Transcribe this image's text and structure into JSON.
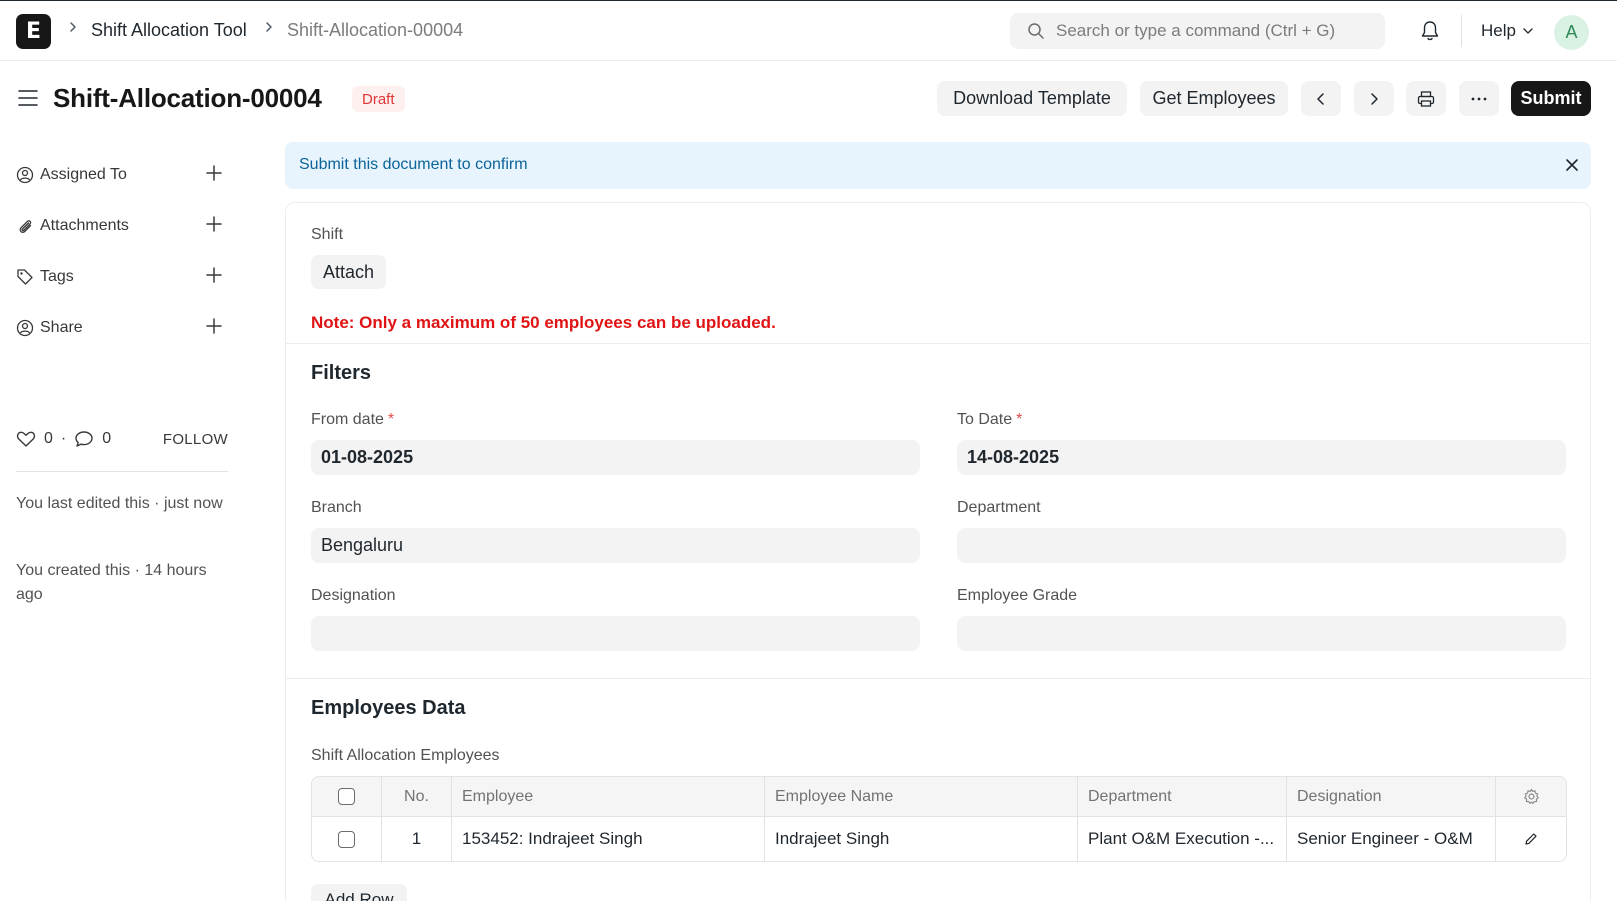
{
  "navbar": {
    "logo_letter": "E",
    "breadcrumbs": [
      "Shift Allocation Tool",
      "Shift-Allocation-00004"
    ],
    "search_placeholder": "Search or type a command (Ctrl + G)",
    "help_label": "Help",
    "avatar_letter": "A"
  },
  "page": {
    "title": "Shift-Allocation-00004",
    "status": "Draft",
    "buttons": {
      "download_template": "Download Template",
      "get_employees": "Get Employees",
      "submit": "Submit"
    }
  },
  "sidebar": {
    "items": [
      {
        "label": "Assigned To",
        "icon": "assign-user-icon"
      },
      {
        "label": "Attachments",
        "icon": "paperclip-icon"
      },
      {
        "label": "Tags",
        "icon": "tag-icon"
      },
      {
        "label": "Share",
        "icon": "share-user-icon"
      }
    ],
    "likes": "0",
    "comments": "0",
    "dot": "·",
    "follow_label": "FOLLOW",
    "last_edited": "You last edited this · just now",
    "created": "You created this · 14 hours ago"
  },
  "alert": {
    "message": "Submit this document to confirm"
  },
  "form": {
    "shift_label": "Shift",
    "attach_label": "Attach",
    "note": "Note: Only a maximum of 50 employees can be uploaded.",
    "filters_title": "Filters",
    "required_mark": "*",
    "fields": {
      "from_date": {
        "label": "From date",
        "value": "01-08-2025"
      },
      "to_date": {
        "label": "To Date",
        "value": "14-08-2025"
      },
      "branch": {
        "label": "Branch",
        "value": "Bengaluru"
      },
      "department": {
        "label": "Department",
        "value": ""
      },
      "designation": {
        "label": "Designation",
        "value": ""
      },
      "employee_grade": {
        "label": "Employee Grade",
        "value": ""
      }
    },
    "employees_title": "Employees Data",
    "table_label": "Shift Allocation Employees",
    "table": {
      "headers": [
        "No.",
        "Employee",
        "Employee Name",
        "Department",
        "Designation"
      ],
      "rows": [
        {
          "no": "1",
          "employee": "153452: Indrajeet Singh",
          "employee_name": "Indrajeet Singh",
          "department": "Plant O&M Execution -...",
          "designation": "Senior Engineer - O&M"
        }
      ]
    },
    "add_row_label": "Add Row"
  },
  "colors": {
    "primary": "#171717",
    "draft_text": "#e03636",
    "note_red": "#e01414",
    "alert_bg": "#e8f4fd",
    "alert_text": "#0b6399"
  }
}
